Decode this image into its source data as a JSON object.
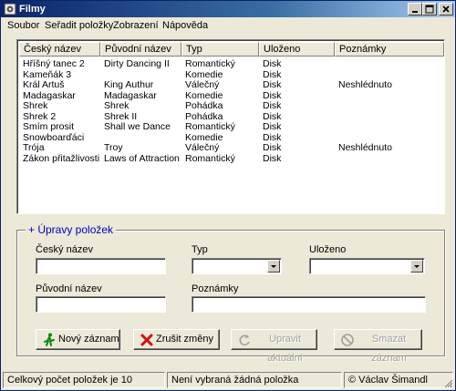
{
  "window": {
    "title": "Filmy"
  },
  "menu": [
    "Soubor",
    "Seřadit položky",
    "Zobrazení",
    "Nápověda"
  ],
  "list": {
    "columns": [
      "Český název",
      "Původní název",
      "Typ",
      "Uloženo",
      "Poznámky"
    ],
    "rows": [
      [
        "Hříšný tanec 2",
        "Dirty Dancing II",
        "Romantický",
        "Disk",
        ""
      ],
      [
        "Kameňák 3",
        "",
        "Komedie",
        "Disk",
        ""
      ],
      [
        "Král Artuš",
        "King Authur",
        "Válečný",
        "Disk",
        "Neshlédnuto"
      ],
      [
        "Madagaskar",
        "Madagaskar",
        "Komedie",
        "Disk",
        ""
      ],
      [
        "Shrek",
        "Shrek",
        "Pohádka",
        "Disk",
        ""
      ],
      [
        "Shrek 2",
        "Shrek II",
        "Pohádka",
        "Disk",
        ""
      ],
      [
        "Smím prosit",
        "Shall we Dance",
        "Romantický",
        "Disk",
        ""
      ],
      [
        "Snowboarďáci",
        "",
        "Komedie",
        "Disk",
        ""
      ],
      [
        "Trója",
        "Troy",
        "Válečný",
        "Disk",
        "Neshlédnuto"
      ],
      [
        "Zákon přitažlivosti",
        "Laws of Attraction",
        "Romantický",
        "Disk",
        ""
      ]
    ]
  },
  "edit": {
    "title": "+ Úpravy položek",
    "label_czech": "Český název",
    "label_type": "Typ",
    "label_stored": "Uloženo",
    "label_original": "Původní název",
    "label_notes": "Poznámky",
    "value_czech": "",
    "value_type": "",
    "value_stored": "",
    "value_original": "",
    "value_notes": ""
  },
  "buttons": {
    "new": "Nový záznam",
    "cancel": "Zrušit změny",
    "update": "Upravit aktuální",
    "delete": "Smazat záznam"
  },
  "status": {
    "count": "Celkový počet položek je 10",
    "selection": "Není vybraná žádná položka",
    "author": "© Václav Šimandl"
  },
  "colors": {
    "group_title": "#0000c0",
    "title_bar": "#0a246a",
    "disabled_text": "#a0a0a0"
  },
  "icons": {
    "app": "film-app-icon",
    "new": "running-man-icon",
    "cancel": "red-x-icon",
    "update": "refresh-icon",
    "delete": "no-entry-icon"
  }
}
